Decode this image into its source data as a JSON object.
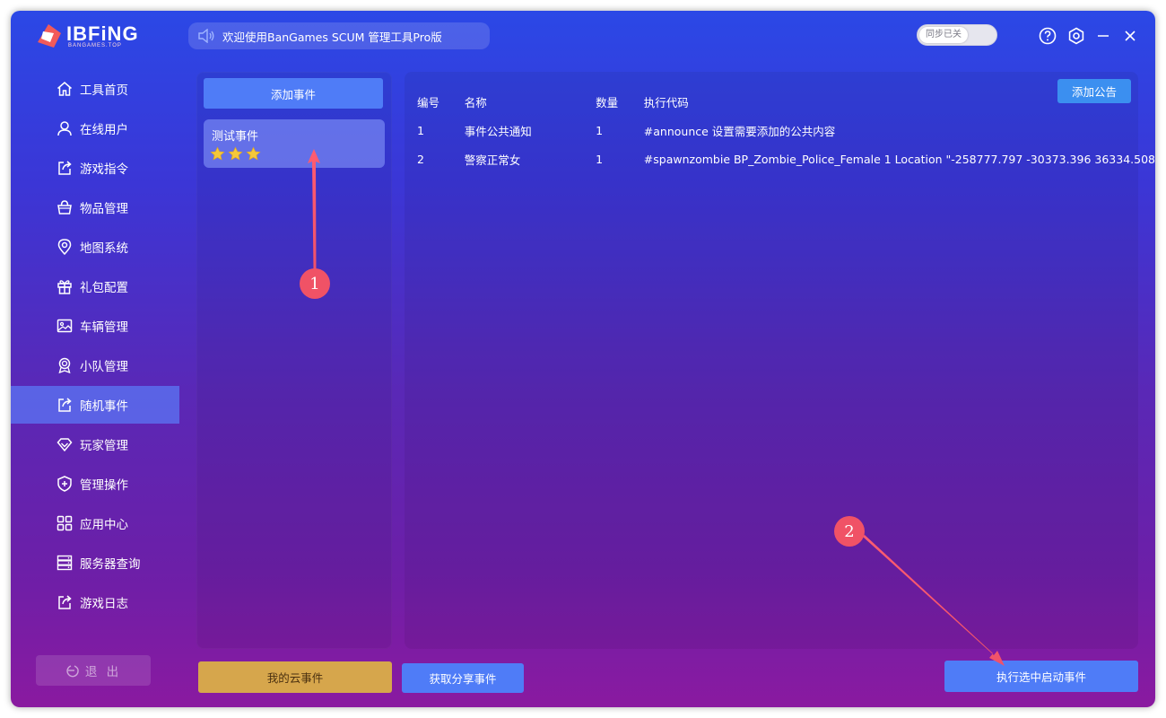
{
  "app": {
    "logo_text": "IBFiNG",
    "logo_sub": "BANGAMES.TOP",
    "notice": "欢迎使用BanGames SCUM 管理工具Pro版",
    "sync_label": "同步已关"
  },
  "sidebar": {
    "items": [
      {
        "label": "工具首页",
        "icon": "home-icon"
      },
      {
        "label": "在线用户",
        "icon": "user-icon"
      },
      {
        "label": "游戏指令",
        "icon": "share-icon"
      },
      {
        "label": "物品管理",
        "icon": "basket-icon"
      },
      {
        "label": "地图系统",
        "icon": "location-icon"
      },
      {
        "label": "礼包配置",
        "icon": "gift-icon"
      },
      {
        "label": "车辆管理",
        "icon": "image-icon"
      },
      {
        "label": "小队管理",
        "icon": "badge-icon"
      },
      {
        "label": "随机事件",
        "icon": "share-icon",
        "active": true
      },
      {
        "label": "玩家管理",
        "icon": "diamond-icon"
      },
      {
        "label": "管理操作",
        "icon": "shield-plus-icon"
      },
      {
        "label": "应用中心",
        "icon": "apps-icon"
      },
      {
        "label": "服务器查询",
        "icon": "server-icon"
      },
      {
        "label": "游戏日志",
        "icon": "share-icon"
      }
    ],
    "logout_label": "退 出"
  },
  "events_panel": {
    "add_button": "添加事件",
    "events": [
      {
        "name": "测试事件",
        "stars": 3
      }
    ]
  },
  "table": {
    "headers": [
      "编号",
      "名称",
      "数量",
      "执行代码"
    ],
    "rows": [
      [
        "1",
        "事件公共通知",
        "1",
        "#announce 设置需要添加的公共内容"
      ],
      [
        "2",
        "警察正常女",
        "1",
        "#spawnzombie BP_Zombie_Police_Female 1 Location \"-258777.797 -30373.396 36334.508"
      ]
    ],
    "add_notice_button": "添加公告"
  },
  "footer": {
    "my_cloud_button": "我的云事件",
    "get_shared_button": "获取分享事件",
    "execute_button": "执行选中启动事件"
  },
  "annotations": [
    {
      "label": "1"
    },
    {
      "label": "2"
    }
  ],
  "colors": {
    "accent_blue": "#4f7cf7",
    "gold": "#d6a64c",
    "annotation_red": "#f05266"
  }
}
